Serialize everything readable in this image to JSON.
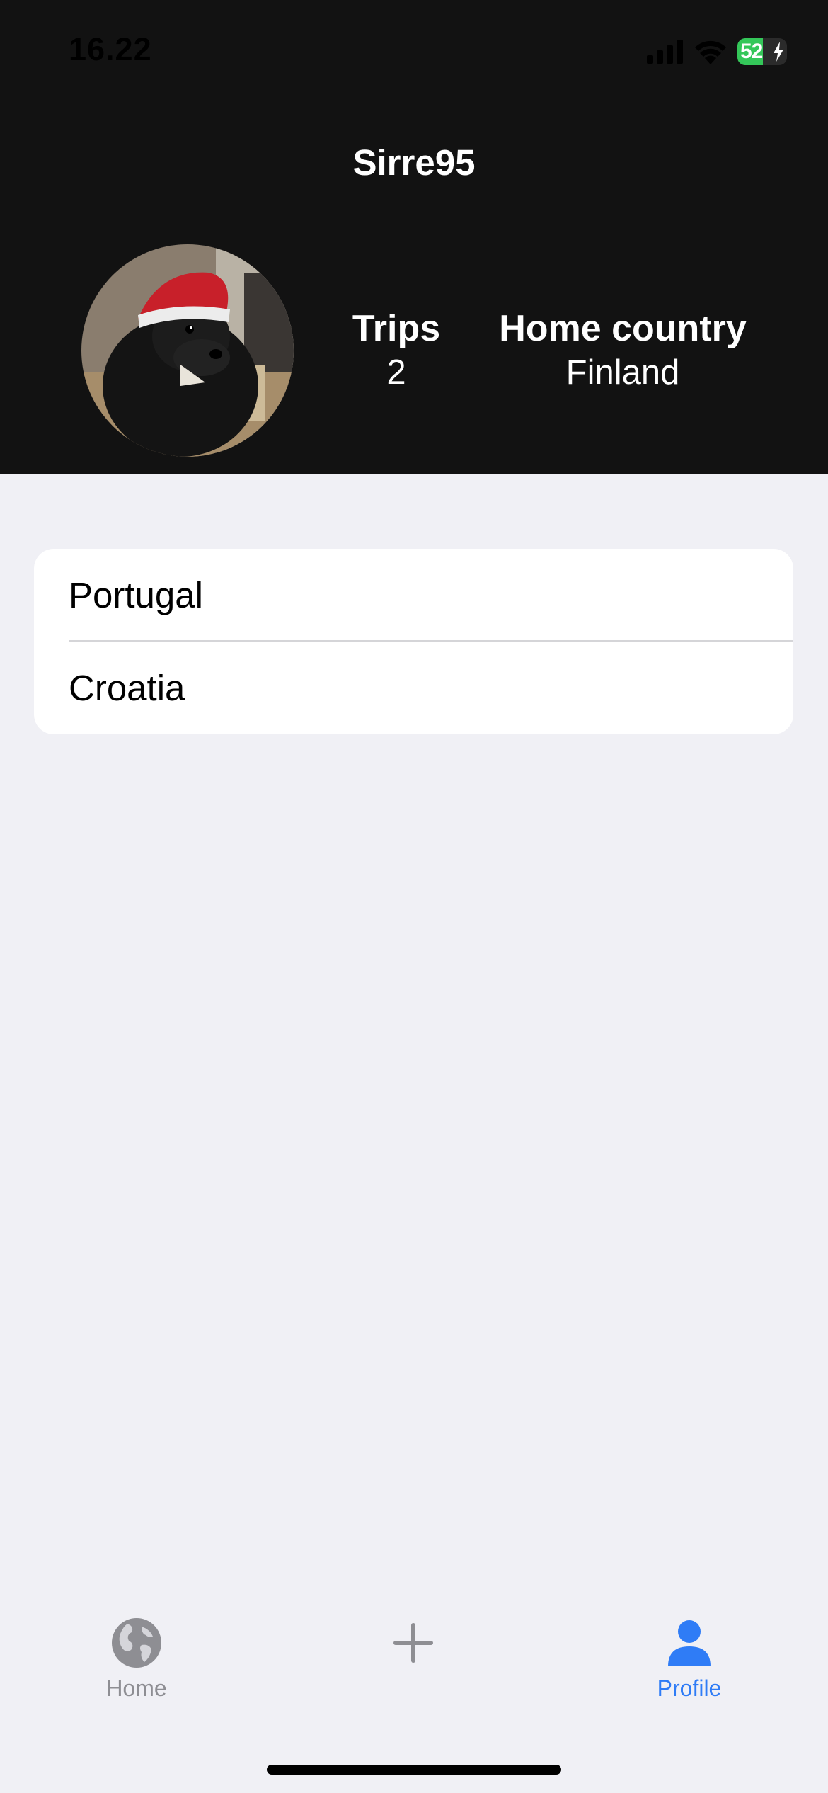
{
  "status_bar": {
    "time": "16.22",
    "battery_level": "52",
    "battery_fraction": 0.52,
    "icons": [
      "cellular-signal-icon",
      "wifi-icon",
      "battery-charging-icon"
    ]
  },
  "profile": {
    "username": "Sirre95",
    "avatar": "dog-in-santa-hat-photo",
    "stats": {
      "trips_label": "Trips",
      "trips_value": "2",
      "home_country_label": "Home country",
      "home_country_value": "Finland"
    }
  },
  "trips": [
    "Portugal",
    "Croatia"
  ],
  "tab_bar": {
    "tabs": [
      {
        "label": "Home",
        "icon": "globe-icon",
        "active": false
      },
      {
        "label": "",
        "icon": "plus-icon",
        "active": false
      },
      {
        "label": "Profile",
        "icon": "person-icon",
        "active": true
      }
    ]
  },
  "colors": {
    "accent": "#2f7cf6",
    "inactive": "#8e8e93",
    "header_bg": "#121212",
    "page_bg": "#f0f0f5",
    "battery_green": "#34c759"
  }
}
